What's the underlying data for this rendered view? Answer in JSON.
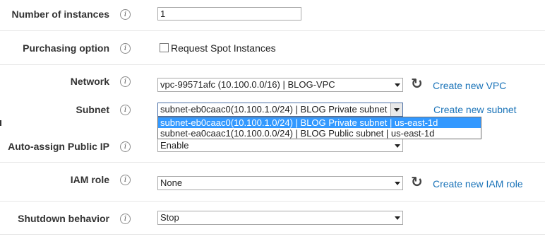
{
  "rows": {
    "instances": {
      "label": "Number of instances",
      "value": "1"
    },
    "purchasing": {
      "label": "Purchasing option",
      "checkbox_label": "Request Spot Instances",
      "checked": false
    },
    "network": {
      "label": "Network",
      "value": "vpc-99571afc (10.100.0.0/16) | BLOG-VPC",
      "link": "Create new VPC"
    },
    "subnet": {
      "label": "Subnet",
      "value": "subnet-eb0caac0(10.100.1.0/24) | BLOG Private subnet | us-east-1d",
      "link": "Create new subnet",
      "options": [
        "subnet-eb0caac0(10.100.1.0/24) | BLOG Private subnet | us-east-1d",
        "subnet-ea0caac1(10.100.0.0/24) | BLOG Public subnet | us-east-1d"
      ]
    },
    "public_ip": {
      "label": "Auto-assign Public IP",
      "value": "Enable"
    },
    "iam": {
      "label": "IAM role",
      "value": "None",
      "link": "Create new IAM role"
    },
    "shutdown": {
      "label": "Shutdown behavior",
      "value": "Stop"
    }
  },
  "icons": {
    "info": "info-icon",
    "refresh": "refresh-icon"
  },
  "colors": {
    "link": "#1a73b8",
    "selection": "#3399ff"
  }
}
